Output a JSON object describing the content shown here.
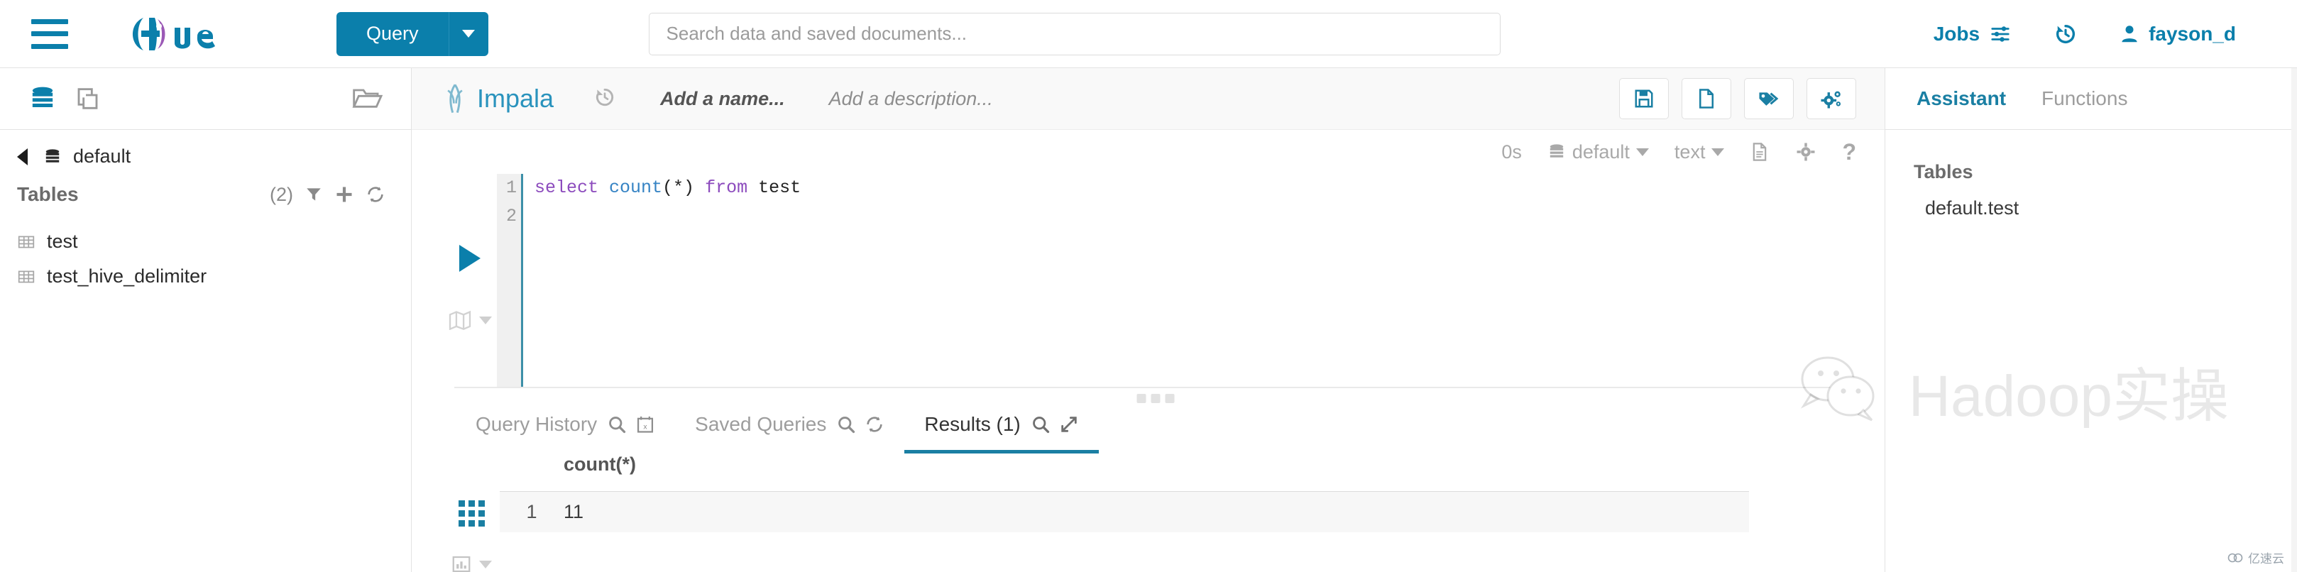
{
  "navbar": {
    "menu_icon": "hamburger-icon",
    "logo_text": "Hue",
    "query_button": "Query",
    "query_dropdown_icon": "chevron-down-icon",
    "search_placeholder": "Search data and saved documents...",
    "search_value": "",
    "jobs_label": "Jobs",
    "jobs_icon": "sliders-icon",
    "history_icon": "history-icon",
    "user_label": "fayson_d",
    "user_icon": "user-icon"
  },
  "sidebar": {
    "top_icons": [
      "database-icon",
      "documents-icon",
      "open-folder-icon"
    ],
    "breadcrumb": "default",
    "breadcrumb_back_icon": "chevron-left-icon",
    "breadcrumb_db_icon": "database-icon",
    "section_title": "Tables",
    "section_count": "(2)",
    "section_icons": [
      "filter-icon",
      "plus-icon",
      "refresh-icon"
    ],
    "tables": [
      {
        "name": "test",
        "icon": "table-icon"
      },
      {
        "name": "test_hive_delimiter",
        "icon": "table-icon"
      }
    ]
  },
  "editor": {
    "engine": "Impala",
    "engine_icon": "impala-icon",
    "history_icon": "history-icon",
    "name_placeholder": "Add a name...",
    "description_placeholder": "Add a description...",
    "tools": [
      {
        "name": "save-button",
        "icon": "floppy-save-icon"
      },
      {
        "name": "new-document-button",
        "icon": "file-icon"
      },
      {
        "name": "tags-button",
        "icon": "tags-icon"
      },
      {
        "name": "settings-button",
        "icon": "gears-icon"
      }
    ],
    "meta": {
      "duration": "0s",
      "database": "default",
      "database_icon": "database-icon",
      "format": "text",
      "doc_icon": "document-icon",
      "gear_icon": "gear-icon",
      "help_icon": "question-mark-icon"
    },
    "run_icon": "play-icon",
    "map_icon": "map-icon",
    "map_caret_icon": "caret-down-icon",
    "line_numbers": [
      "1",
      "2"
    ],
    "sql": {
      "keyword_1": "select",
      "function_1": "count",
      "paren_star": "(*)",
      "keyword_2": "from",
      "table": "test"
    }
  },
  "tabs": [
    {
      "label": "Query History",
      "active": false,
      "icons": [
        "search-icon",
        "calendar-x-icon"
      ]
    },
    {
      "label": "Saved Queries",
      "active": false,
      "icons": [
        "search-icon",
        "refresh-icon"
      ]
    },
    {
      "label": "Results (1)",
      "active": true,
      "icons": [
        "search-icon",
        "expand-icon"
      ]
    }
  ],
  "results": {
    "grid_view_icon": "grid-icon",
    "chart_view_icon": "bar-chart-icon",
    "chart_caret_icon": "caret-down-icon",
    "columns": [
      "count(*)"
    ],
    "rows": [
      {
        "index": "1",
        "values": [
          "11"
        ]
      }
    ]
  },
  "assistant": {
    "tabs": [
      {
        "label": "Assistant",
        "active": true
      },
      {
        "label": "Functions",
        "active": false
      }
    ],
    "section_title": "Tables",
    "items": [
      "default.test"
    ]
  },
  "watermark": {
    "text": "Hadoop实操",
    "icon": "wechat-bubbles-icon",
    "brand": "亿速云"
  },
  "colors": {
    "accent": "#0b7fab",
    "engine_blue": "#2a93bd",
    "logo_purple": "#9b59b6",
    "keyword_purple": "#8c4bbd",
    "function_blue": "#3583c4"
  }
}
